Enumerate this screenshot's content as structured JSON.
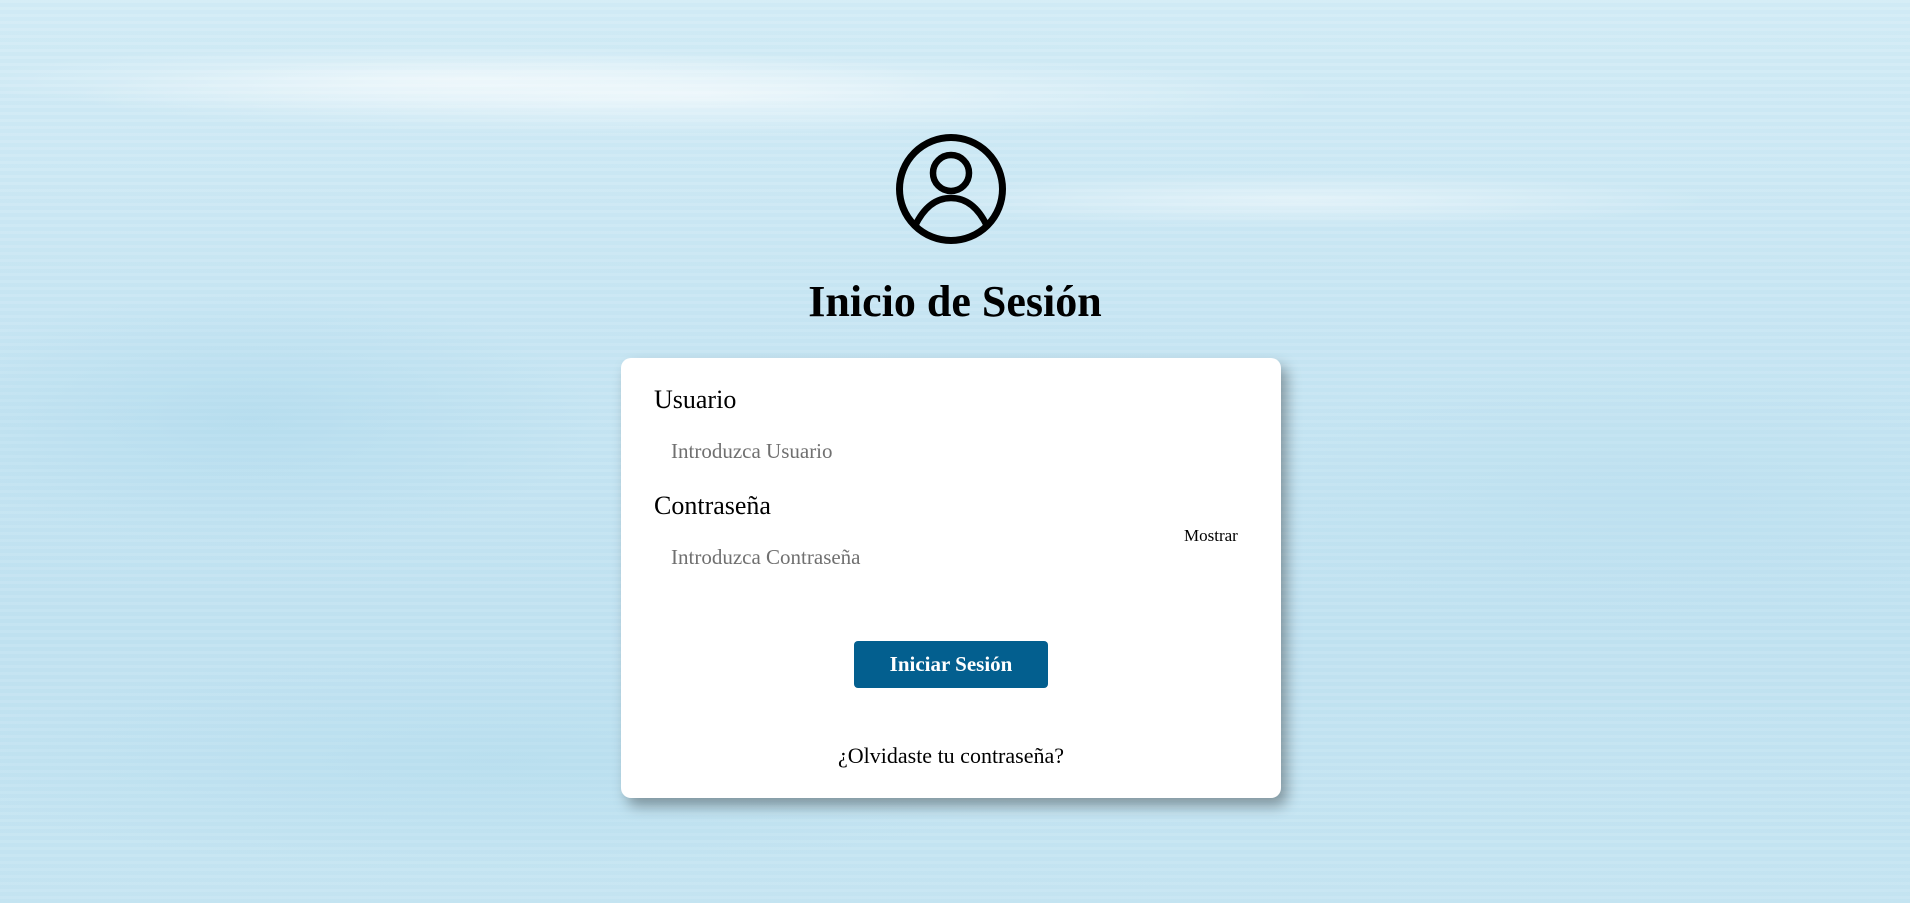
{
  "header": {
    "avatar_icon": "user-circle-icon",
    "title": "Inicio de Sesión"
  },
  "form": {
    "username": {
      "label": "Usuario",
      "placeholder": "Introduzca Usuario",
      "value": ""
    },
    "password": {
      "label": "Contraseña",
      "placeholder": "Introduzca Contraseña",
      "value": "",
      "toggle_label": "Mostrar"
    },
    "submit_label": "Iniciar Sesión",
    "forgot_link": "¿Olvidaste tu contraseña?"
  },
  "colors": {
    "button_bg": "#035f8f",
    "button_text": "#ffffff",
    "card_bg": "#ffffff",
    "background": "#c8e6f3"
  }
}
